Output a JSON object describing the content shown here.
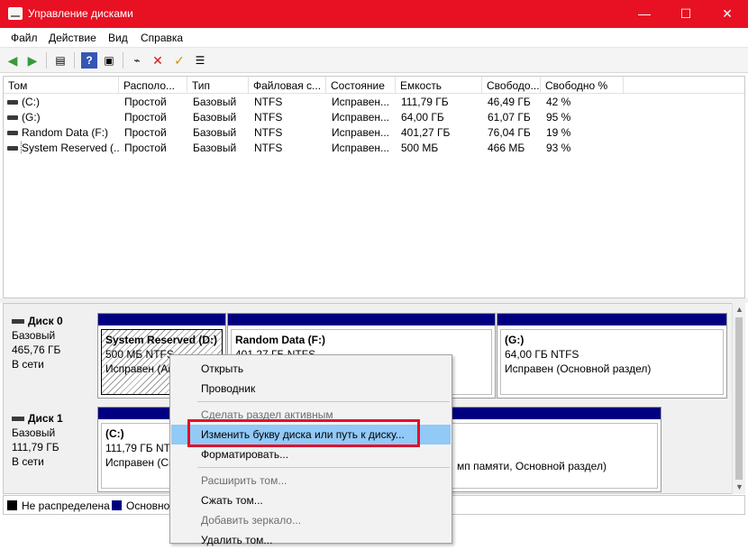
{
  "window": {
    "title": "Управление дисками",
    "controls": {
      "minimize": "—",
      "maximize": "☐",
      "close": "✕"
    },
    "accent": "#e81123"
  },
  "menu": [
    "Файл",
    "Действие",
    "Вид",
    "Справка"
  ],
  "toolbar": {
    "buttons": [
      "back-icon",
      "forward-icon",
      "properties-icon",
      "help-icon",
      "console-icon",
      "connect-icon",
      "delete-icon",
      "check-icon",
      "settings-icon"
    ]
  },
  "volume_list": {
    "columns": [
      "Том",
      "Располо...",
      "Тип",
      "Файловая с...",
      "Состояние",
      "Емкость",
      "Свободо...",
      "Свободно %"
    ],
    "rows": [
      [
        "(C:)",
        "Простой",
        "Базовый",
        "NTFS",
        "Исправен...",
        "111,79 ГБ",
        "46,49 ГБ",
        "42 %"
      ],
      [
        "(G:)",
        "Простой",
        "Базовый",
        "NTFS",
        "Исправен...",
        "64,00 ГБ",
        "61,07 ГБ",
        "95 %"
      ],
      [
        "Random Data (F:)",
        "Простой",
        "Базовый",
        "NTFS",
        "Исправен...",
        "401,27 ГБ",
        "76,04 ГБ",
        "19 %"
      ],
      [
        "System Reserved (...",
        "Простой",
        "Базовый",
        "NTFS",
        "Исправен...",
        "500 МБ",
        "466 МБ",
        "93 %"
      ]
    ]
  },
  "disks": [
    {
      "name": "Диск 0",
      "type": "Базовый",
      "size": "465,76 ГБ",
      "status": "В сети",
      "partitions": [
        {
          "name": "System Reserved  (D:)",
          "size": "500 МБ NTFS",
          "status": "Исправен (Ак"
        },
        {
          "name": "Random Data  (F:)",
          "size": "401,27 ГБ NTFS",
          "status": ""
        },
        {
          "name": "(G:)",
          "size": "64,00 ГБ NTFS",
          "status": "Исправен (Основной раздел)"
        }
      ]
    },
    {
      "name": "Диск 1",
      "type": "Базовый",
      "size": "111,79 ГБ",
      "status": "В сети",
      "partitions": [
        {
          "name": "(C:)",
          "size": "111,79 ГБ NTF",
          "status": "Исправен (Си",
          "status_tail": "мп памяти, Основной раздел)"
        }
      ]
    }
  ],
  "legend": [
    {
      "label": "Не распределена",
      "color": "#000000"
    },
    {
      "label": "Основно",
      "color": "#000080"
    }
  ],
  "context_menu": {
    "items": [
      {
        "label": "Открыть",
        "disabled": false
      },
      {
        "label": "Проводник",
        "disabled": false
      },
      {
        "label": "Сделать раздел активным",
        "disabled": true
      },
      {
        "label": "Изменить букву диска или путь к диску...",
        "disabled": false,
        "highlighted": true
      },
      {
        "label": "Форматировать...",
        "disabled": false
      },
      {
        "label": "Расширить том...",
        "disabled": true
      },
      {
        "label": "Сжать том...",
        "disabled": false
      },
      {
        "label": "Добавить зеркало...",
        "disabled": true
      },
      {
        "label": "Удалить том...",
        "disabled": false
      }
    ],
    "highlight_color": "#91c9f7",
    "annotation_color": "#e3102a"
  }
}
